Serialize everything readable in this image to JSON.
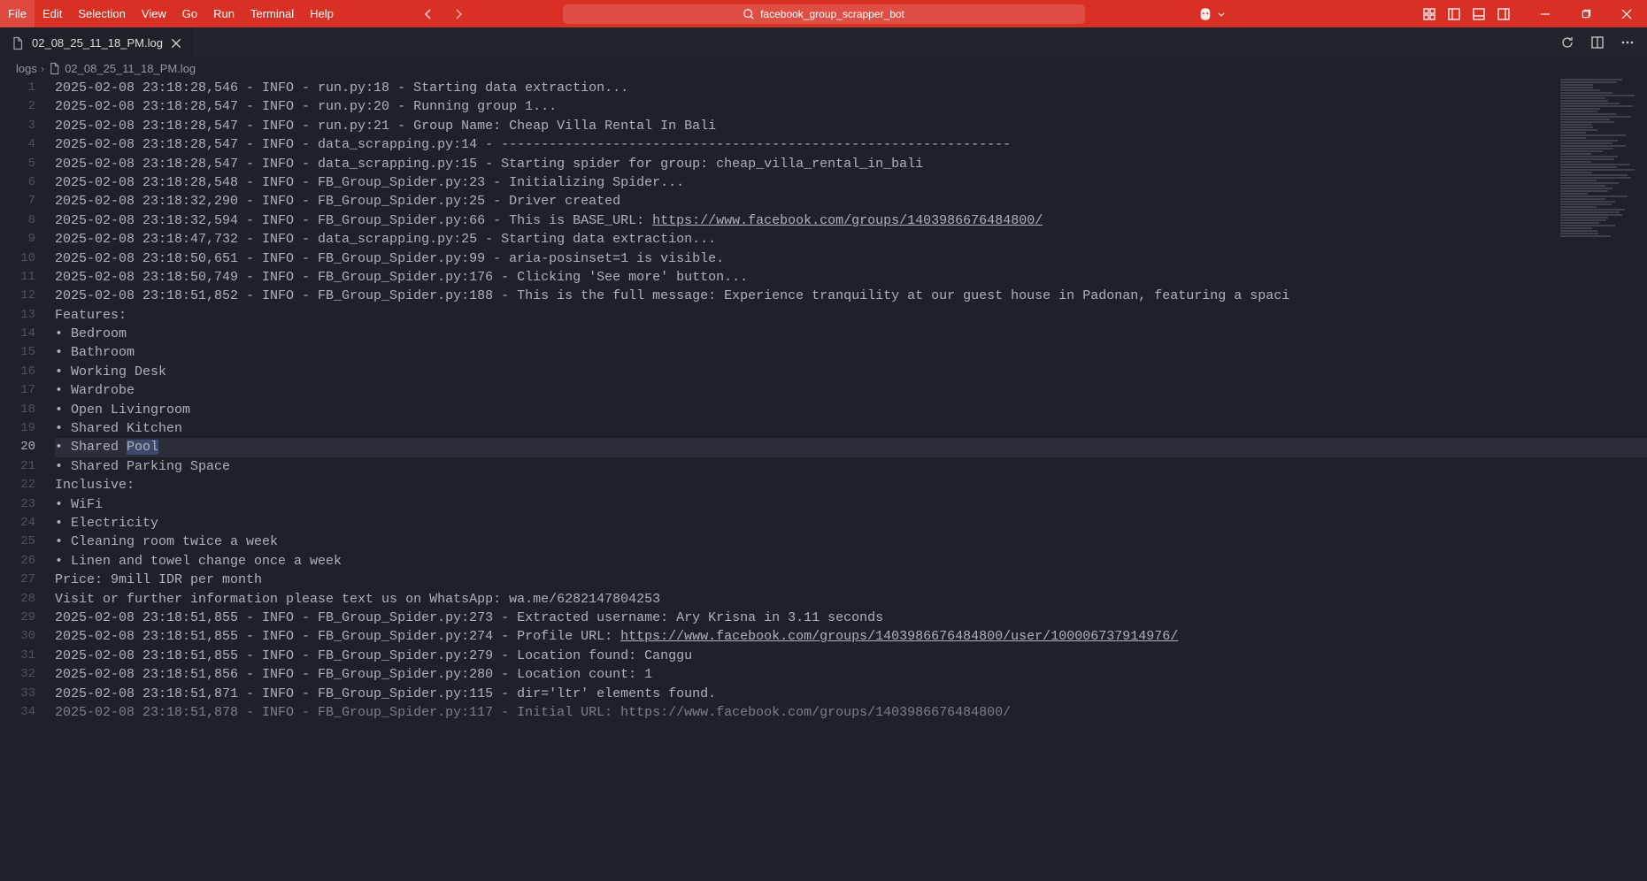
{
  "menu": [
    "File",
    "Edit",
    "Selection",
    "View",
    "Go",
    "Run",
    "Terminal",
    "Help"
  ],
  "search": {
    "text": "facebook_group_scrapper_bot"
  },
  "tab": {
    "filename": "02_08_25_11_18_PM.log"
  },
  "breadcrumb": {
    "folder": "logs",
    "file": "02_08_25_11_18_PM.log"
  },
  "active_line": 20,
  "selection": {
    "line": 20,
    "prefix": "• Shared ",
    "text": "Pool"
  },
  "lines": [
    {
      "n": 1,
      "text": "2025-02-08 23:18:28,546 - INFO - run.py:18 - Starting data extraction..."
    },
    {
      "n": 2,
      "text": "2025-02-08 23:18:28,547 - INFO - run.py:20 - Running group 1..."
    },
    {
      "n": 3,
      "text": "2025-02-08 23:18:28,547 - INFO - run.py:21 - Group Name: Cheap Villa Rental In Bali"
    },
    {
      "n": 4,
      "text": "2025-02-08 23:18:28,547 - INFO - data_scrapping.py:14 - ----------------------------------------------------------------"
    },
    {
      "n": 5,
      "text": "2025-02-08 23:18:28,547 - INFO - data_scrapping.py:15 - Starting spider for group: cheap_villa_rental_in_bali"
    },
    {
      "n": 6,
      "text": "2025-02-08 23:18:28,548 - INFO - FB_Group_Spider.py:23 - Initializing Spider..."
    },
    {
      "n": 7,
      "text": "2025-02-08 23:18:32,290 - INFO - FB_Group_Spider.py:25 - Driver created"
    },
    {
      "n": 8,
      "text": "2025-02-08 23:18:32,594 - INFO - FB_Group_Spider.py:66 - This is BASE_URL: ",
      "url": "https://www.facebook.com/groups/1403986676484800/"
    },
    {
      "n": 9,
      "text": "2025-02-08 23:18:47,732 - INFO - data_scrapping.py:25 - Starting data extraction..."
    },
    {
      "n": 10,
      "text": "2025-02-08 23:18:50,651 - INFO - FB_Group_Spider.py:99 - aria-posinset=1 is visible."
    },
    {
      "n": 11,
      "text": "2025-02-08 23:18:50,749 - INFO - FB_Group_Spider.py:176 - Clicking 'See more' button..."
    },
    {
      "n": 12,
      "text": "2025-02-08 23:18:51,852 - INFO - FB_Group_Spider.py:188 - This is the full message: Experience tranquility at our guest house in Padonan, featuring a spaci"
    },
    {
      "n": 13,
      "text": "Features:"
    },
    {
      "n": 14,
      "text": "• Bedroom"
    },
    {
      "n": 15,
      "text": "• Bathroom"
    },
    {
      "n": 16,
      "text": "• Working Desk"
    },
    {
      "n": 17,
      "text": "• Wardrobe"
    },
    {
      "n": 18,
      "text": "• Open Livingroom"
    },
    {
      "n": 19,
      "text": "• Shared Kitchen"
    },
    {
      "n": 20,
      "text": "• Shared Pool"
    },
    {
      "n": 21,
      "text": "• Shared Parking Space"
    },
    {
      "n": 22,
      "text": "Inclusive:"
    },
    {
      "n": 23,
      "text": "• WiFi"
    },
    {
      "n": 24,
      "text": "• Electricity"
    },
    {
      "n": 25,
      "text": "• Cleaning room twice a week"
    },
    {
      "n": 26,
      "text": "• Linen and towel change once a week"
    },
    {
      "n": 27,
      "text": "Price: 9mill IDR per month"
    },
    {
      "n": 28,
      "text": "Visit or further information please text us on WhatsApp: wa.me/6282147804253"
    },
    {
      "n": 29,
      "text": "2025-02-08 23:18:51,855 - INFO - FB_Group_Spider.py:273 - Extracted username: Ary Krisna in 3.11 seconds"
    },
    {
      "n": 30,
      "text": "2025-02-08 23:18:51,855 - INFO - FB_Group_Spider.py:274 - Profile URL: ",
      "url": "https://www.facebook.com/groups/1403986676484800/user/100006737914976/"
    },
    {
      "n": 31,
      "text": "2025-02-08 23:18:51,855 - INFO - FB_Group_Spider.py:279 - Location found: Canggu"
    },
    {
      "n": 32,
      "text": "2025-02-08 23:18:51,856 - INFO - FB_Group_Spider.py:280 - Location count: 1"
    },
    {
      "n": 33,
      "text": "2025-02-08 23:18:51,871 - INFO - FB_Group_Spider.py:115 - dir='ltr' elements found."
    },
    {
      "n": 34,
      "text": "2025-02-08 23:18:51,878 - INFO - FB_Group_Spider.py:117 - Initial URL: https://www.facebook.com/groups/1403986676484800/",
      "faded": true
    }
  ]
}
